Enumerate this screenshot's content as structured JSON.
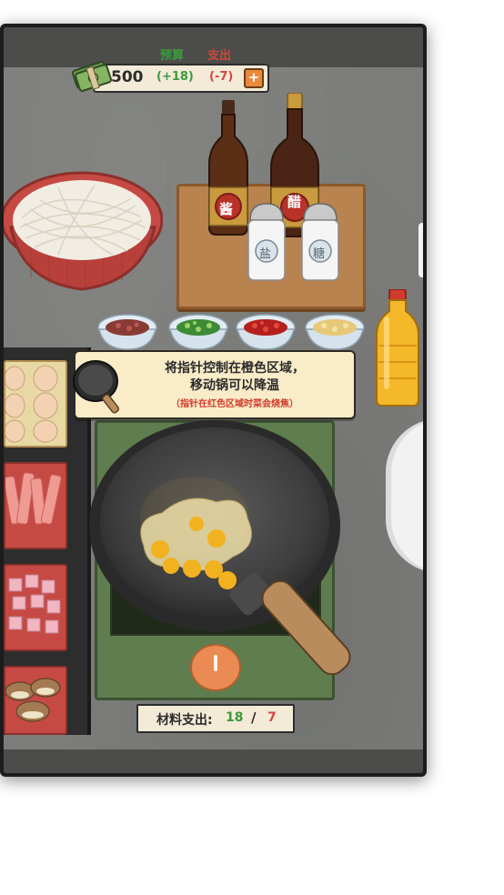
{
  "hud": {
    "budget_label": "预算",
    "spend_label": "支出",
    "money": "500",
    "income": "(+18)",
    "expense": "(-7)",
    "plus_symbol": "+"
  },
  "condiments": {
    "soy_sauce": "酱",
    "vinegar": "醋",
    "salt": "盐",
    "sugar": "糖"
  },
  "tip": {
    "line1": "将指针控制在橙色区域，",
    "line2": "移动锅可以降温",
    "warning": "（指针在红色区域时菜会烧焦）"
  },
  "cost": {
    "label": "材料支出:",
    "used": "18",
    "slash": "/",
    "max": "7"
  },
  "colors": {
    "income": "#3d9a3d",
    "expense": "#d0483e",
    "warning": "#d23a2c",
    "tip_bg": "#faecc9"
  }
}
